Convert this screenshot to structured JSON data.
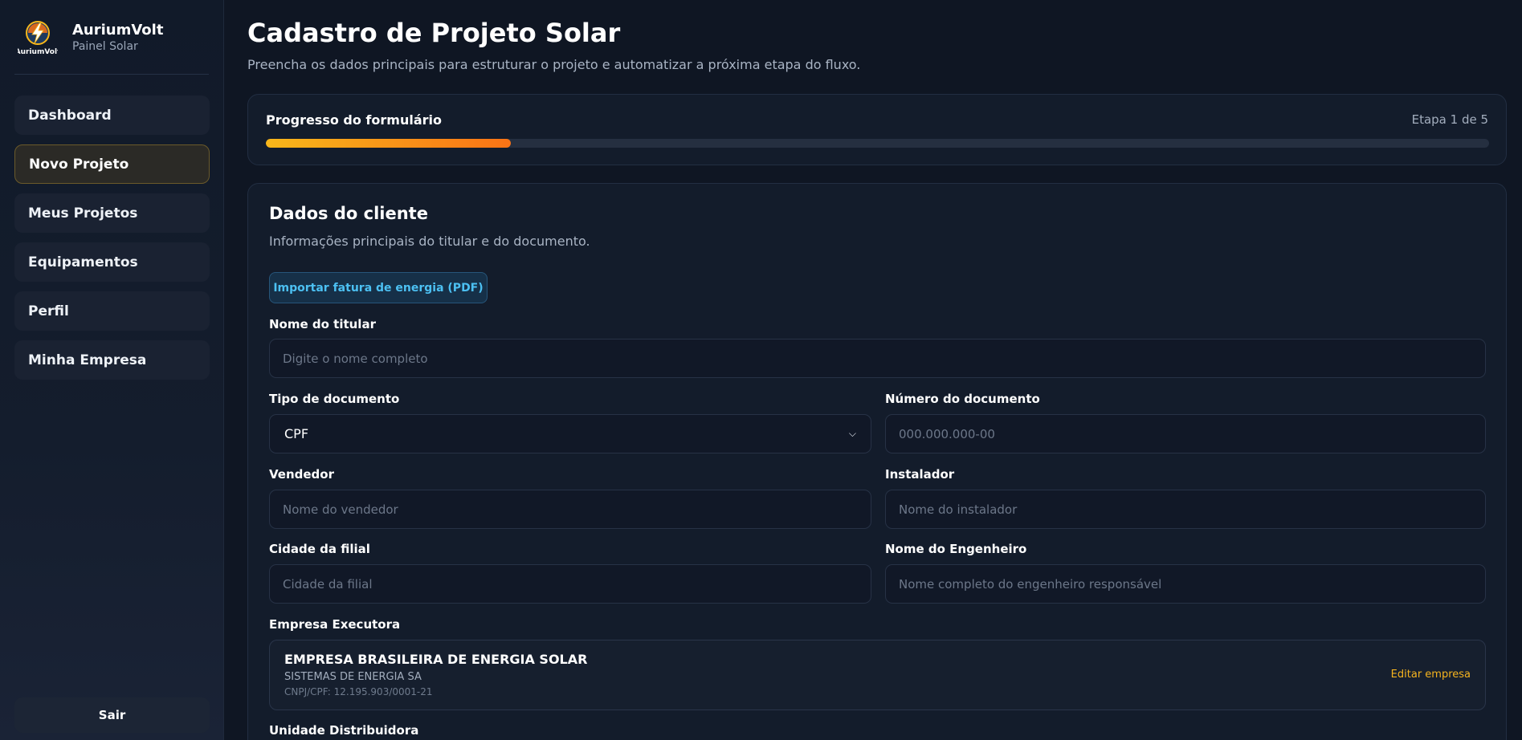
{
  "brand": {
    "name": "AuriumVolt",
    "subtitle": "Painel Solar",
    "logo_text": "AuriumVolt"
  },
  "sidebar": {
    "items": [
      {
        "label": "Dashboard",
        "active": false
      },
      {
        "label": "Novo Projeto",
        "active": true
      },
      {
        "label": "Meus Projetos",
        "active": false
      },
      {
        "label": "Equipamentos",
        "active": false
      },
      {
        "label": "Perfil",
        "active": false
      },
      {
        "label": "Minha Empresa",
        "active": false
      }
    ],
    "logout_label": "Sair"
  },
  "header": {
    "title": "Cadastro de Projeto Solar",
    "subtitle": "Preencha os dados principais para estruturar o projeto e automatizar a próxima etapa do fluxo."
  },
  "progress": {
    "label": "Progresso do formulário",
    "step_text": "Etapa 1 de 5",
    "fraction": 0.2
  },
  "form": {
    "section_title": "Dados do cliente",
    "section_subtitle": "Informações principais do titular e do documento.",
    "import_button": "Importar fatura de energia (PDF)",
    "titular": {
      "label": "Nome do titular",
      "placeholder": "Digite o nome completo",
      "value": ""
    },
    "doc_type": {
      "label": "Tipo de documento",
      "value": "CPF"
    },
    "doc_number": {
      "label": "Número do documento",
      "placeholder": "000.000.000-00",
      "value": ""
    },
    "vendedor": {
      "label": "Vendedor",
      "placeholder": "Nome do vendedor",
      "value": ""
    },
    "instalador": {
      "label": "Instalador",
      "placeholder": "Nome do instalador",
      "value": ""
    },
    "cidade": {
      "label": "Cidade da filial",
      "placeholder": "Cidade da filial",
      "value": ""
    },
    "engenheiro": {
      "label": "Nome do Engenheiro",
      "placeholder": "Nome completo do engenheiro responsável",
      "value": ""
    },
    "empresa": {
      "label": "Empresa Executora",
      "name": "EMPRESA BRASILEIRA DE ENERGIA SOLAR",
      "subtitle": "SISTEMAS DE ENERGIA SA",
      "document": "CNPJ/CPF: 12.195.903/0001-21",
      "edit_label": "Editar empresa"
    },
    "distribuidora_label": "Unidade Distribuidora"
  },
  "colors": {
    "accent": "#f8b71a",
    "accent_end": "#f97316",
    "link": "#4cc0f2",
    "background": "#0f1623"
  }
}
